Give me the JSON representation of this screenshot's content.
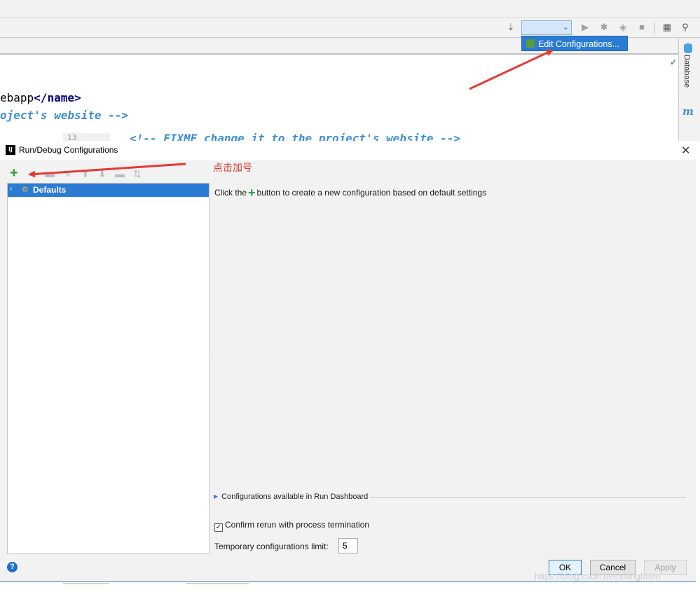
{
  "editor": {
    "code_line_1_text": "ebapp",
    "code_line_1_tag_open": "</",
    "code_line_1_tag_name": "name",
    "code_line_1_tag_close": ">",
    "code_line_2": "oject's website -->",
    "code_fragment": "<!-- FIXME change it to the project's website -->",
    "gutter_fragment": "13"
  },
  "toolbar": {
    "edit_configurations_label": "Edit Configurations..."
  },
  "side_panel": {
    "database_label": "Database",
    "maven_glyph": "m"
  },
  "dialog": {
    "title": "Run/Debug Configurations",
    "app_icon_text": "IJ",
    "close_glyph": "✕",
    "annotation": "点击加号",
    "tree": {
      "selected_item": "Defaults"
    },
    "hint_before": "Click the",
    "hint_plus": "+",
    "hint_after": "button to create a new configuration based on default settings",
    "run_dashboard_label": "Configurations available in Run Dashboard",
    "confirm_rerun_label": "Confirm rerun with process termination",
    "confirm_rerun_checked": true,
    "temp_limit_label": "Temporary configurations limit:",
    "temp_limit_value": "5",
    "help_glyph": "?",
    "buttons": {
      "ok": "OK",
      "cancel": "Cancel",
      "apply": "Apply"
    }
  },
  "watermark": "https://blog.csdn.net/xiangbaoo",
  "colors": {
    "selection_blue": "#2b7bd4",
    "add_green": "#2e9a3e",
    "annotation_red": "#e53935",
    "dialog_bg": "#f2f2f2"
  }
}
